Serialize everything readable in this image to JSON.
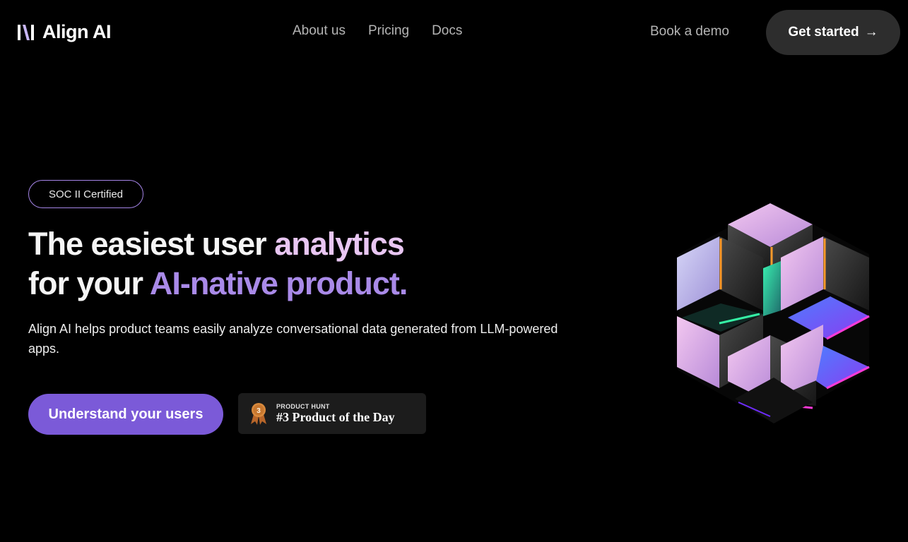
{
  "brand": {
    "name": "Align AI"
  },
  "nav": {
    "links": [
      "About us",
      "Pricing",
      "Docs"
    ],
    "book_demo": "Book a demo",
    "get_started": "Get started",
    "get_started_arrow": "→"
  },
  "hero": {
    "badge": "SOC II Certified",
    "headline": {
      "line1_white": "The easiest user ",
      "line1_pink": "analytics",
      "line2_white": "for your ",
      "line2_purple": "AI-native product."
    },
    "subtext": "Align AI helps product teams easily analyze conversational data generated from LLM-powered apps.",
    "cta": "Understand your users",
    "product_hunt": {
      "label": "PRODUCT HUNT",
      "title": "#3 Product of the Day",
      "rank": "3"
    }
  },
  "colors": {
    "background": "#000000",
    "accent_purple": "#7b5ad8",
    "headline_pink": "#e8c6f2",
    "headline_purple": "#a98ae8",
    "nav_text": "#b5b5b5"
  }
}
